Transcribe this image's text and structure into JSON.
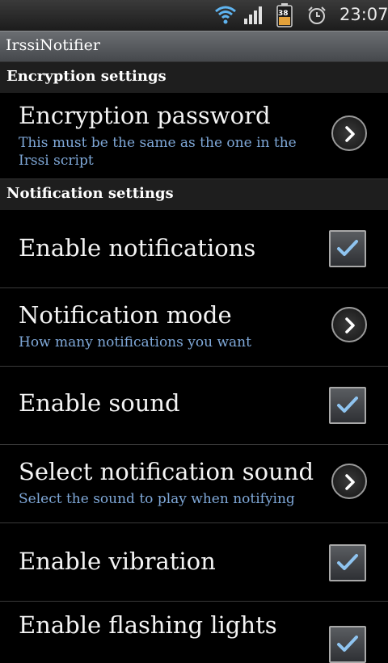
{
  "status_bar": {
    "time": "23:07",
    "battery_level": "38",
    "icons": [
      "wifi-icon",
      "signal-icon",
      "battery-icon",
      "alarm-icon"
    ]
  },
  "app": {
    "title": "IrssiNotifier"
  },
  "sections": [
    {
      "header": "Encryption settings",
      "items": [
        {
          "title": "Encryption password",
          "summary": "This must be the same as the one in the Irssi script",
          "widget": "chevron"
        }
      ]
    },
    {
      "header": "Notification settings",
      "items": [
        {
          "title": "Enable notifications",
          "summary": "",
          "widget": "checkbox",
          "checked": true
        },
        {
          "title": "Notification mode",
          "summary": "How many notifications you want",
          "widget": "chevron"
        },
        {
          "title": "Enable sound",
          "summary": "",
          "widget": "checkbox",
          "checked": true
        },
        {
          "title": "Select notification sound",
          "summary": "Select the sound to play when notifying",
          "widget": "chevron"
        },
        {
          "title": "Enable vibration",
          "summary": "",
          "widget": "checkbox",
          "checked": true
        },
        {
          "title": "Enable flashing lights",
          "summary": "",
          "widget": "checkbox",
          "checked": true
        }
      ]
    }
  ],
  "colors": {
    "summary_text": "#7fa8d8",
    "check_mark": "#8fc4f0",
    "background": "#000000"
  }
}
